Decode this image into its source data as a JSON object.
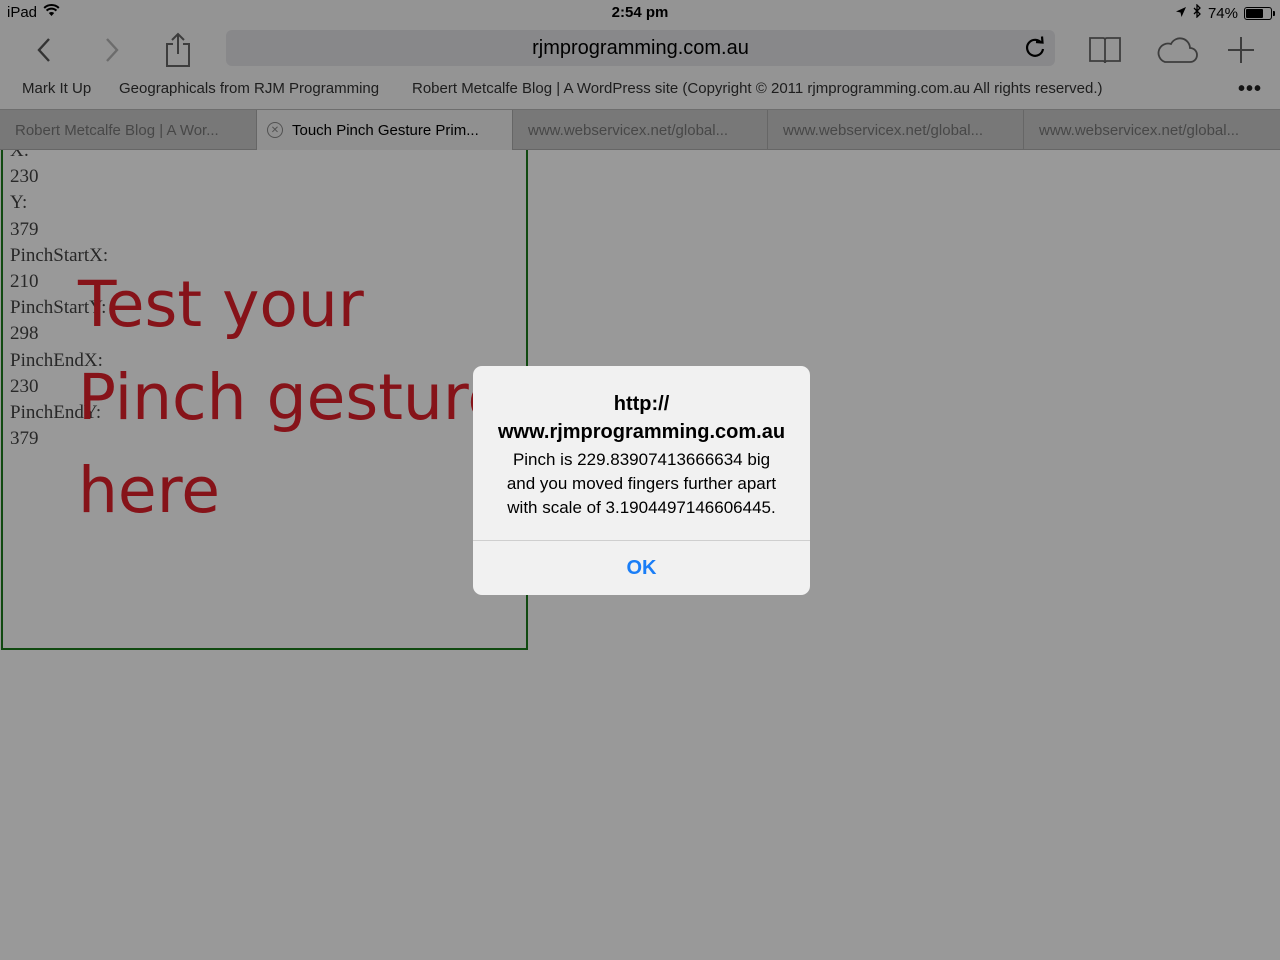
{
  "status_bar": {
    "device": "iPad",
    "time": "2:54 pm",
    "battery": "74%",
    "battery_level": 0.74,
    "icons": [
      "wifi-icon",
      "location-arrow-icon",
      "bluetooth-icon",
      "battery-icon"
    ]
  },
  "toolbar": {
    "url": "rjmprogramming.com.au",
    "icons": [
      "back-icon",
      "forward-icon",
      "share-icon",
      "reload-icon",
      "bookmarks-book-icon",
      "icloud-tabs-icon",
      "new-tab-plus-icon"
    ]
  },
  "bookmarks": [
    "Mark It Up",
    "Geographicals from RJM Programming",
    "Robert Metcalfe Blog | A WordPress site (Copyright © 2011 rjmprogramming.com.au All rights reserved.)"
  ],
  "bookmarks_more": "•••",
  "tabs": [
    {
      "label": "Robert Metcalfe Blog | A Wor...",
      "active": false
    },
    {
      "label": "Touch Pinch Gesture Prim...",
      "active": true
    },
    {
      "label": "www.webservicex.net/global...",
      "active": false
    },
    {
      "label": "www.webservicex.net/global...",
      "active": false
    },
    {
      "label": "www.webservicex.net/global...",
      "active": false
    }
  ],
  "page": {
    "readout": [
      {
        "label": "X:",
        "value": "230"
      },
      {
        "label": "Y:",
        "value": "379"
      },
      {
        "label": "PinchStartX:",
        "value": "210"
      },
      {
        "label": "PinchStartY:",
        "value": "298"
      },
      {
        "label": "PinchEndX:",
        "value": "230"
      },
      {
        "label": "PinchEndY:",
        "value": "379"
      }
    ],
    "prompt_lines": [
      "Test your",
      "Pinch gesture",
      "here"
    ]
  },
  "alert": {
    "title_line1": "http://",
    "title_line2": "www.rjmprogramming.com.au",
    "message_line1": "Pinch is 229.83907413666634 big",
    "message_line2": "and you moved fingers further apart",
    "message_line3": "with scale of 3.1904497146606445.",
    "ok_label": "OK"
  },
  "colors": {
    "alert_button": "#1a7ef7",
    "prompt_text": "#e0202a",
    "pinch_border": "#1c7a1c"
  }
}
